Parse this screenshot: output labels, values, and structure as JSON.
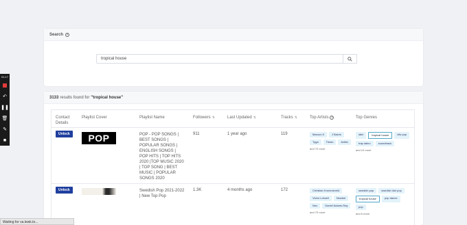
{
  "recorder": {
    "time": "01:17"
  },
  "search": {
    "title": "Search",
    "query": "tropical house"
  },
  "results": {
    "count": "3133",
    "label": "results found for",
    "query": "\"tropical house\""
  },
  "table": {
    "headers": {
      "contact": "Contact Details",
      "cover": "Playlist Cover",
      "name": "Playlist Name",
      "followers": "Followers",
      "updated": "Last Updated",
      "tracks": "Tracks",
      "artists": "Top Artists",
      "genres": "Top Genres"
    },
    "rows": [
      {
        "unlock": "Unlock",
        "cover_text": "POP",
        "name": "POP - POP SONGS | BEST SONGS | POPULAR SONGS | ENGLISH SONGS | POP HITS | TOP HITS 2020 |TOP MUSIC 2020 | TOP SONG | BEST MUSIC | POPULAR SONGS 2020",
        "followers": "911",
        "updated": "1 year ago",
        "tracks": "119",
        "artists": [
          "Maroon 5",
          "J Balvin",
          "Tyga",
          "Tiesto",
          "Anitta"
        ],
        "artists_more": "and 70 more",
        "genres": [
          "latin",
          "tropical house",
          "dfw pop",
          "trap latino",
          "soundtrack"
        ],
        "genres_more": "and 10 more"
      },
      {
        "unlock": "Unlock",
        "name": "Swedish Pop 2021-2022 | New Top Pop",
        "followers": "1.3K",
        "updated": "4 months ago",
        "tracks": "172",
        "artists": [
          "Christian Kroneneveld",
          "Victor Leksell",
          "Newkid",
          "Neo",
          "Daniel Adams-Ray"
        ],
        "artists_more": "and 70 more",
        "genres": [
          "swedish pop",
          "swedish idol pop",
          "tropical house",
          "pop dance",
          "pop"
        ],
        "genres_more": "and 6 more"
      }
    ]
  },
  "status": {
    "text": "Waiting for va.lewk.to..."
  }
}
